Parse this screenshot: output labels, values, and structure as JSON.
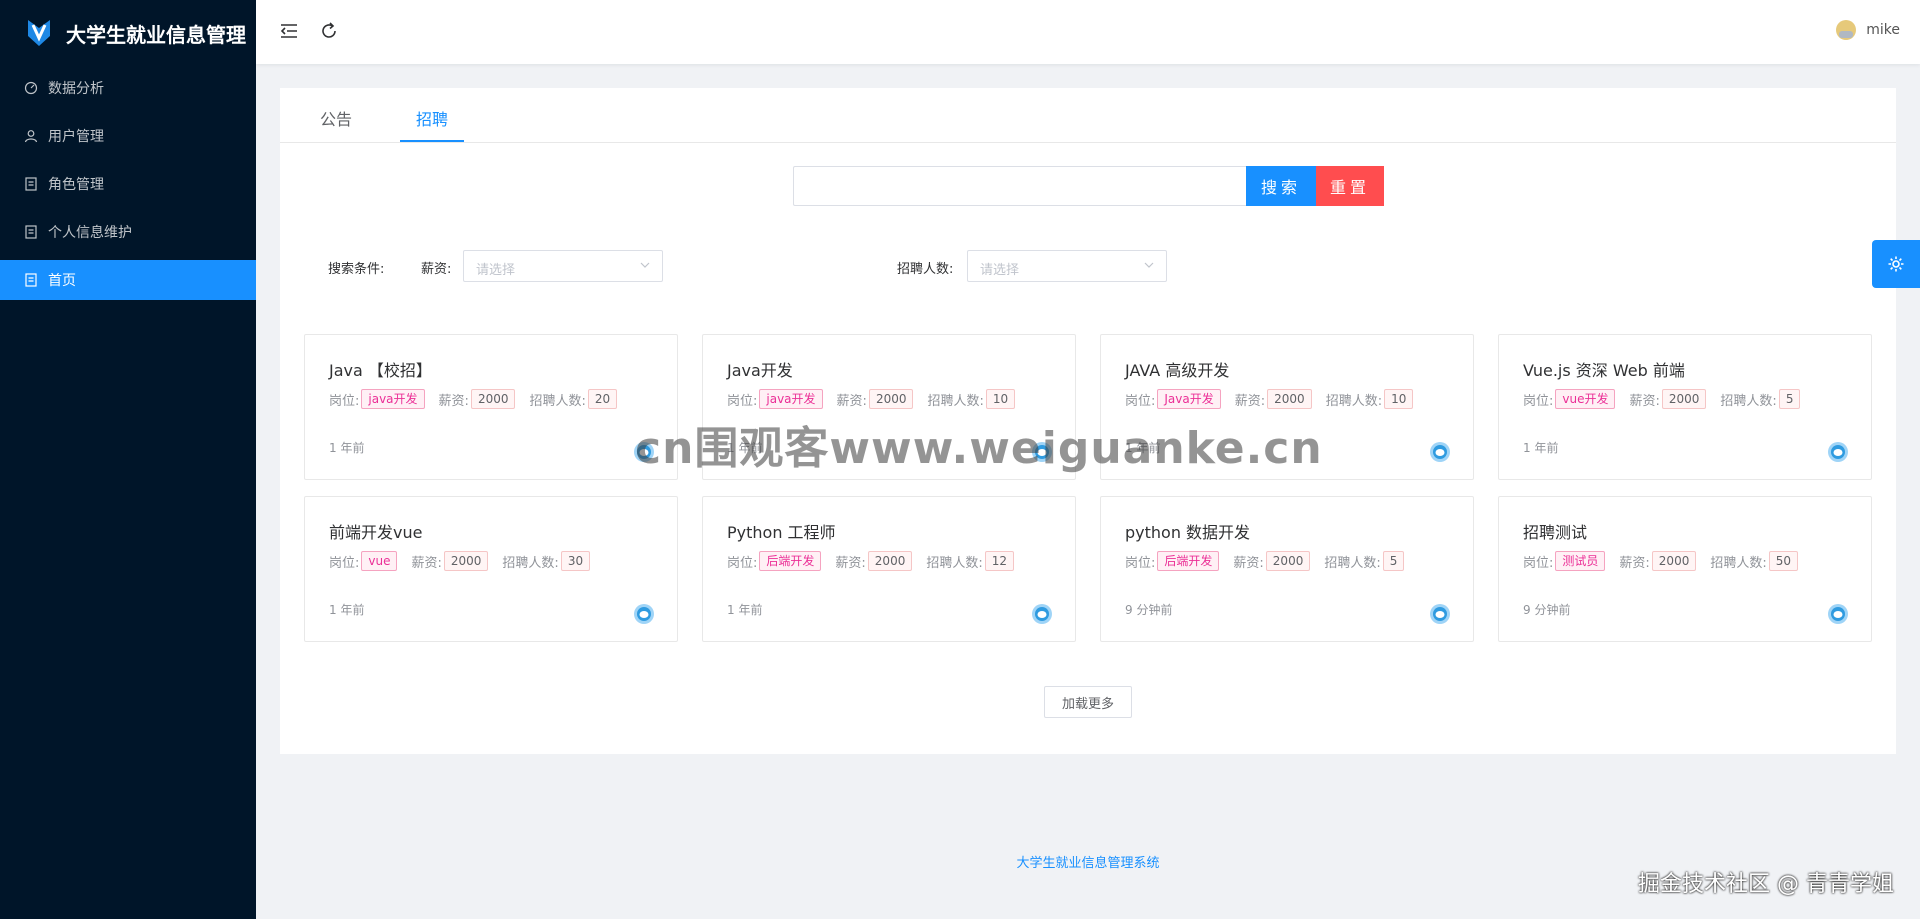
{
  "app": {
    "title": "大学生就业信息管理"
  },
  "sidebar": {
    "items": [
      {
        "label": "数据分析",
        "icon": "dashboard-icon",
        "active": false
      },
      {
        "label": "用户管理",
        "icon": "user-icon",
        "active": false
      },
      {
        "label": "角色管理",
        "icon": "document-icon",
        "active": false
      },
      {
        "label": "个人信息维护",
        "icon": "document-icon",
        "active": false
      },
      {
        "label": "首页",
        "icon": "document-icon",
        "active": true
      }
    ]
  },
  "header": {
    "collapse_icon": "menu-fold-icon",
    "refresh_icon": "refresh-icon",
    "user_name": "mike"
  },
  "tabs": [
    {
      "label": "公告",
      "active": false
    },
    {
      "label": "招聘",
      "active": true
    }
  ],
  "search": {
    "value": "",
    "placeholder": "",
    "search_label": "搜索",
    "reset_label": "重置"
  },
  "filters": {
    "label": "搜索条件:",
    "salary_label": "薪资:",
    "salary_placeholder": "请选择",
    "count_label": "招聘人数:",
    "count_placeholder": "请选择"
  },
  "job_labels": {
    "position": "岗位:",
    "salary": "薪资:",
    "count": "招聘人数:"
  },
  "jobs": [
    {
      "title": "Java 【校招】",
      "position": "java开发",
      "salary": "2000",
      "count": "20",
      "time": "1 年前"
    },
    {
      "title": "Java开发",
      "position": "java开发",
      "salary": "2000",
      "count": "10",
      "time": "1 年前"
    },
    {
      "title": "JAVA 高级开发",
      "position": "Java开发",
      "salary": "2000",
      "count": "10",
      "time": "1 年前"
    },
    {
      "title": "Vue.js 资深 Web 前端",
      "position": "vue开发",
      "salary": "2000",
      "count": "5",
      "time": "1 年前"
    },
    {
      "title": "前端开发vue",
      "position": "vue",
      "salary": "2000",
      "count": "30",
      "time": "1 年前"
    },
    {
      "title": "Python 工程师",
      "position": "后端开发",
      "salary": "2000",
      "count": "12",
      "time": "1 年前"
    },
    {
      "title": "python 数据开发",
      "position": "后端开发",
      "salary": "2000",
      "count": "5",
      "time": "9 分钟前"
    },
    {
      "title": "招聘测试",
      "position": "测试员",
      "salary": "2000",
      "count": "50",
      "time": "9 分钟前"
    }
  ],
  "load_more_label": "加载更多",
  "footer": {
    "text": "大学生就业信息管理系统"
  },
  "watermark": {
    "text": "cn围观客www.weiguanke.cn"
  },
  "corner_mark": {
    "text": "掘金技术社区 @ 青青学姐"
  },
  "colors": {
    "sidebar_bg": "#001529",
    "primary": "#1890ff",
    "danger": "#ff4d4f",
    "tag_pink": "#eb2f96"
  }
}
